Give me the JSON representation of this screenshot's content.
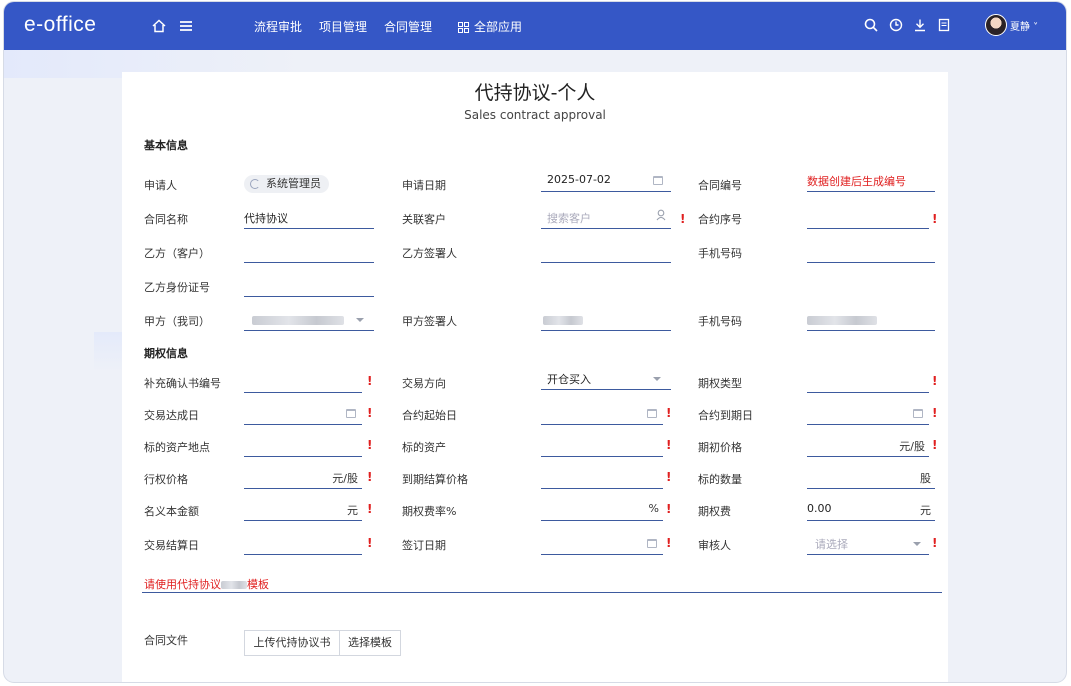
{
  "app": {
    "logo": "e-office",
    "nav": [
      "流程审批",
      "项目管理",
      "合同管理"
    ],
    "all_apps": "全部应用",
    "username": "夏静",
    "accent": "#3557c6"
  },
  "form": {
    "title": "代持协议-个人",
    "subtitle": "Sales contract approval",
    "section_basic": "基本信息",
    "section_option": "期权信息",
    "applicant_label": "申请人",
    "applicant_value": "系统管理员",
    "apply_date_label": "申请日期",
    "apply_date_value": "2025-07-02",
    "contract_no_label": "合同编号",
    "contract_no_value": "数据创建后生成编号",
    "contract_name_label": "合同名称",
    "contract_name_value": "代持协议",
    "related_customer_label": "关联客户",
    "related_customer_placeholder": "搜索客户",
    "contract_seq_label": "合约序号",
    "party_b_label": "乙方（客户）",
    "party_b_signer_label": "乙方签署人",
    "phone_label": "手机号码",
    "party_b_id_label": "乙方身份证号",
    "party_a_label": "甲方（我司）",
    "party_a_signer_label": "甲方签署人",
    "phone2_label": "手机号码",
    "supp_confirm_label": "补充确认书编号",
    "trade_direction_label": "交易方向",
    "trade_direction_value": "开仓买入",
    "option_type_label": "期权类型",
    "trade_date_label": "交易达成日",
    "start_date_label": "合约起始日",
    "end_date_label": "合约到期日",
    "asset_location_label": "标的资产地点",
    "asset_label": "标的资产",
    "initial_price_label": "期初价格",
    "initial_price_unit": "元/股",
    "strike_price_label": "行权价格",
    "strike_price_unit": "元/股",
    "settle_price_label": "到期结算价格",
    "asset_qty_label": "标的数量",
    "asset_qty_unit": "股",
    "notional_label": "名义本金额",
    "notional_unit": "元",
    "fee_rate_label": "期权费率%",
    "fee_rate_unit": "%",
    "fee_label": "期权费",
    "fee_value": "0.00",
    "fee_unit": "元",
    "settle_date_label": "交易结算日",
    "sign_date_label": "签订日期",
    "reviewer_label": "审核人",
    "reviewer_placeholder": "请选择",
    "template_notice_a": "请使用代持协议",
    "template_notice_b": "模板",
    "contract_file_label": "合同文件",
    "upload_button": "上传代持协议书",
    "choose_template_button": "选择模板"
  }
}
